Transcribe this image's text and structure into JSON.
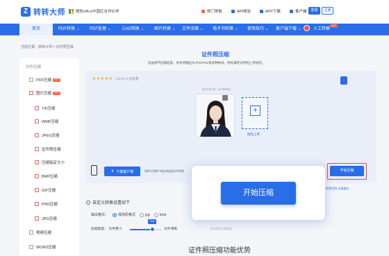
{
  "brand": {
    "name": "转转大师",
    "logo_glyph": "Z",
    "partner": "微软office中国区合作伙伴",
    "color": "#2a6de8"
  },
  "toplinks": [
    {
      "label": "热门导航",
      "icon": "fire-icon",
      "color": "#ff6a2c"
    },
    {
      "label": "API体验",
      "icon": "api-icon",
      "color": "#2a6de8"
    },
    {
      "label": "APP下载",
      "icon": "phone-icon",
      "color": "#2a6de8"
    },
    {
      "label": "客户端",
      "icon": "download-icon",
      "color": "#2a6de8"
    }
  ],
  "auth": {
    "login": "登录",
    "register": "注册"
  },
  "nav": {
    "home": "首页",
    "items": [
      "PDF转换 ⌄",
      "PDF处理 ⌄",
      "CAD转换 ⌄",
      "图片转换 ⌄",
      "文件压缩 ⌄",
      "电子书转换 ⌄",
      "使用技巧 ⌄",
      "客户端下载 ⌄",
      "人工转换"
    ],
    "hot_badge": "HOT"
  },
  "breadcrumb": "当前位置：转转大师 > 证件照压缩",
  "sidebar": {
    "title": "文件压缩",
    "items": [
      {
        "label": "PDF压缩",
        "badge": "HOT",
        "icon": "pdf-icon"
      },
      {
        "label": "图片压缩",
        "badge": "HOT",
        "icon": "image-icon"
      },
      {
        "label": "TIF压缩",
        "badge": "",
        "icon": "tif-icon"
      },
      {
        "label": "WMF压缩",
        "badge": "",
        "icon": "wmf-icon"
      },
      {
        "label": "JPEG压缩",
        "badge": "",
        "icon": "jpeg-icon"
      },
      {
        "label": "证件照压缩",
        "badge": "",
        "icon": "id-photo-icon"
      },
      {
        "label": "压缩指定大小",
        "badge": "",
        "icon": "target-size-icon"
      },
      {
        "label": "BMP压缩",
        "badge": "",
        "icon": "bmp-icon"
      },
      {
        "label": "GIF压缩",
        "badge": "",
        "icon": "gif-icon"
      },
      {
        "label": "PNG压缩",
        "badge": "",
        "icon": "png-icon"
      },
      {
        "label": "JPG压缩",
        "badge": "",
        "icon": "jpg-icon"
      },
      {
        "label": "视频压缩",
        "badge": "",
        "icon": "video-icon"
      },
      {
        "label": "WORD压缩",
        "badge": "",
        "icon": "word-icon"
      }
    ]
  },
  "main": {
    "title": "证件照压缩",
    "subtitle": "自由调节压缩程度、并支持输出为JPG\\PNG等多种格式，轻松满足证件照上传规范。",
    "rating_stars": "★★★★★",
    "rating_text": "4.9 分 | 5 次投票",
    "photo_size": "(jinxng-28...(2.89M))",
    "add_label": "继续上传",
    "download_btn": "下载客户端",
    "download_note": "转转大师客户端支持批量文件转换",
    "start_label": "开始压缩",
    "trial_note": "免费试用·压缩通过",
    "advantages_title": "证件照压缩功能优势"
  },
  "settings": {
    "title": "自定义转换设置如下",
    "format_label": "输出格式：",
    "formats": [
      {
        "label": "保持原格式",
        "selected": true
      },
      {
        "label": "jpg",
        "selected": false
      },
      {
        "label": "bmp",
        "selected": false
      }
    ],
    "format_hint": "温馨提示：压缩后格式，若选择所列格式文件格式",
    "compress_label": "压缩程度：",
    "low_label": "文件更小",
    "high_label": "文件清晰",
    "slider_value_label": "70%",
    "slider_value": 0.7,
    "compress_hint": "支持调节压缩程度"
  },
  "popup": {
    "button": "开始压缩"
  }
}
